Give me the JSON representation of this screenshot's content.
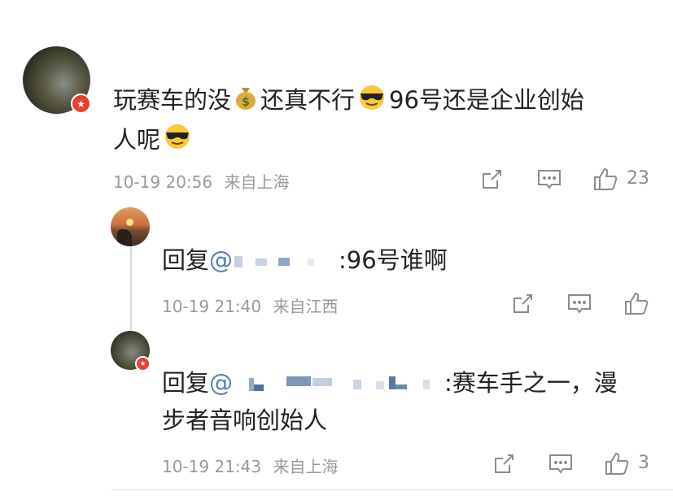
{
  "comment": {
    "text_a": "玩赛车的没",
    "text_b": "还真不行",
    "text_c": "96号还是企业创始",
    "text_d": "人呢",
    "time": "10-19 20:56",
    "location": "来自上海",
    "like_count": "23"
  },
  "replies": [
    {
      "prefix": "回复",
      "at": "@",
      "text": ":96号谁啊",
      "time": "10-19 21:40",
      "location": "来自江西",
      "like_count": ""
    },
    {
      "prefix": "回复",
      "at": "@",
      "text_line1": ":赛车手之一，漫",
      "text_line2": "步者音响创始人",
      "time": "10-19 21:43",
      "location": "来自上海",
      "like_count": "3"
    }
  ],
  "icons": {
    "share": "share-icon",
    "comment": "comment-icon",
    "like": "thumbs-up-icon",
    "money_bag": "money-bag-emoji",
    "sunglasses": "sunglasses-emoji",
    "verified": "verified-badge-icon"
  },
  "colors": {
    "text": "#222222",
    "meta": "#9a9a9a",
    "mention": "#5a7fb0",
    "badge": "#e8412c"
  }
}
